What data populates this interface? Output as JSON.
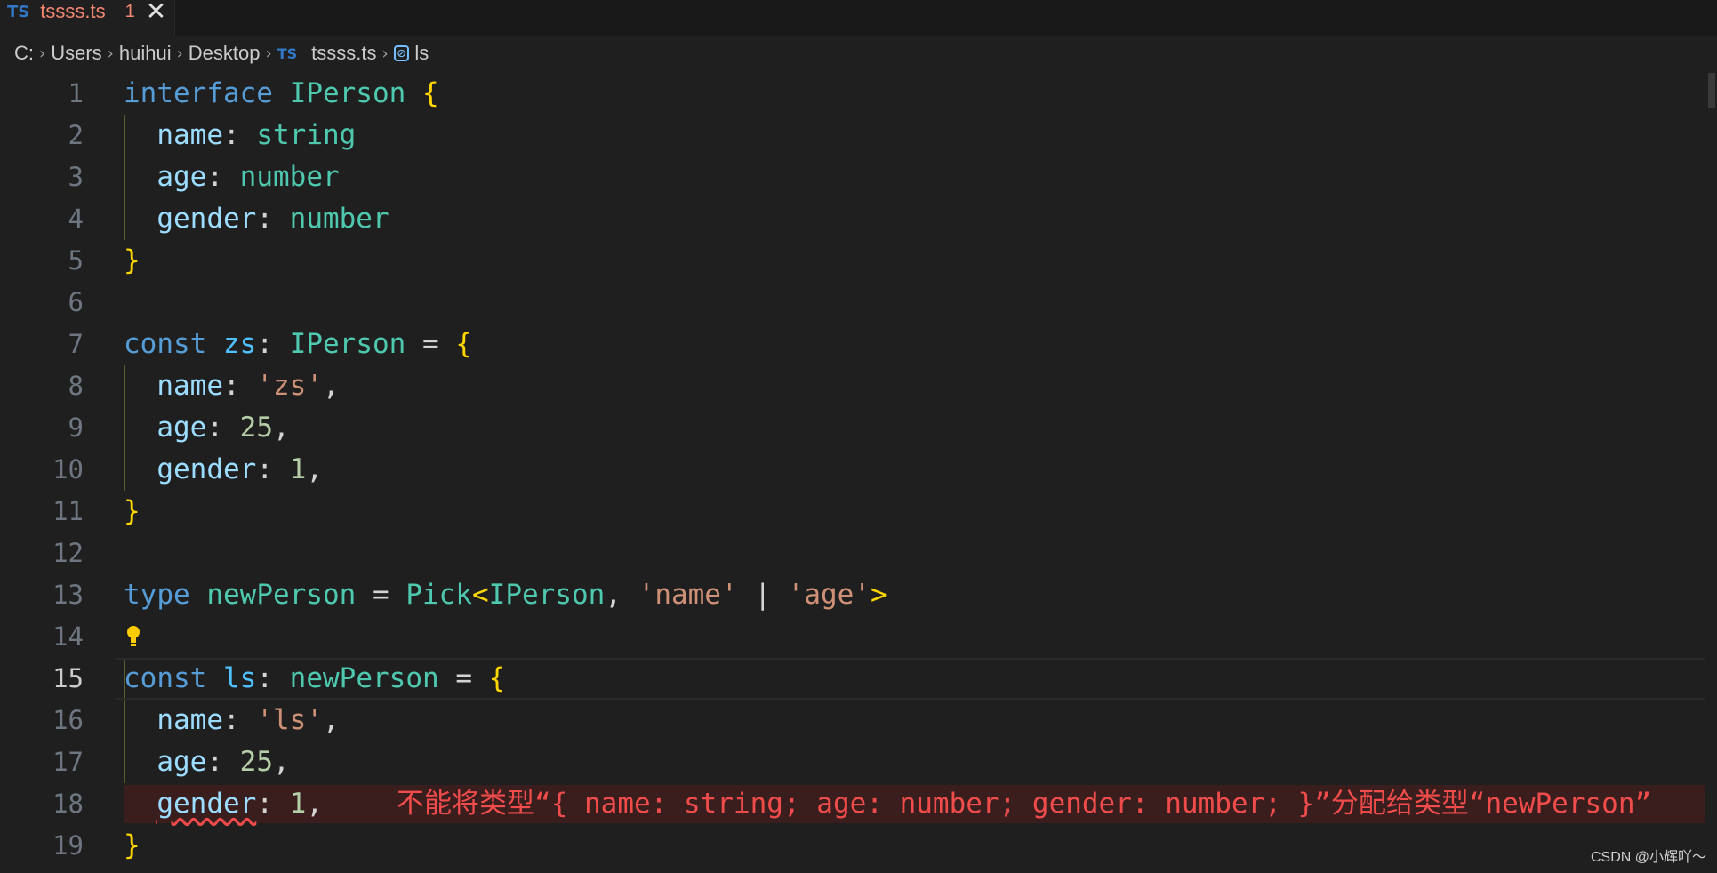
{
  "tab": {
    "icon_text": "TS",
    "filename": "tssss.ts",
    "problem_count": "1",
    "close_glyph": "✕"
  },
  "breadcrumb": {
    "items": [
      "C:",
      "Users",
      "huihui",
      "Desktop",
      "tssss.ts",
      "ls"
    ],
    "file_icon_text": "TS",
    "symbol_icon": "symbol-variable-icon"
  },
  "editor": {
    "line_numbers": [
      "1",
      "2",
      "3",
      "4",
      "5",
      "6",
      "7",
      "8",
      "9",
      "10",
      "11",
      "12",
      "13",
      "14",
      "15",
      "16",
      "17",
      "18",
      "19"
    ],
    "active_line": "15",
    "error_message": "不能将类型“{ name: string; age: number; gender: number; }”分配给类型“newPerson”"
  },
  "watermark": "CSDN @小辉吖～",
  "colors": {
    "keyword": "#569cd6",
    "type": "#4ec9b0",
    "string": "#ce9178",
    "number": "#b5cea8",
    "property": "#9cdcfe",
    "bracket": "#ffd700",
    "error": "#f14c4c"
  }
}
